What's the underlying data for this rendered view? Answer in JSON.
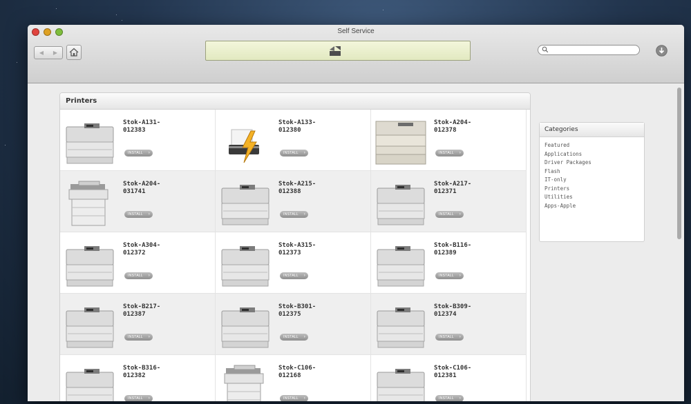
{
  "window": {
    "title": "Self Service",
    "search_placeholder": "",
    "nav_back_label": "◀",
    "nav_forward_label": "▶"
  },
  "printers_panel": {
    "title": "Printers",
    "items": [
      {
        "name": "Stok-A131-\n012383",
        "button": "INSTALL",
        "icon": "laser-printer-icon"
      },
      {
        "name": "Stok-A133-\n012380",
        "button": "INSTALL",
        "icon": "printer-lightning-icon"
      },
      {
        "name": "Stok-A204-\n012378",
        "button": "INSTALL",
        "icon": "tray-printer-icon"
      },
      {
        "name": "Stok-A204-\n031741",
        "button": "INSTALL",
        "icon": "copier-icon"
      },
      {
        "name": "Stok-A215-\n012388",
        "button": "INSTALL",
        "icon": "laser-printer-icon"
      },
      {
        "name": "Stok-A217-\n012371",
        "button": "INSTALL",
        "icon": "laser-printer-icon"
      },
      {
        "name": "Stok-A304-\n012372",
        "button": "INSTALL",
        "icon": "laser-printer-icon"
      },
      {
        "name": "Stok-A315-\n012373",
        "button": "INSTALL",
        "icon": "laser-printer-icon"
      },
      {
        "name": "Stok-B116-\n012389",
        "button": "INSTALL",
        "icon": "laser-printer-icon"
      },
      {
        "name": "Stok-B217-\n012387",
        "button": "INSTALL",
        "icon": "laser-printer-icon"
      },
      {
        "name": "Stok-B301-\n012375",
        "button": "INSTALL",
        "icon": "laser-printer-icon"
      },
      {
        "name": "Stok-B309-\n012374",
        "button": "INSTALL",
        "icon": "laser-printer-icon"
      },
      {
        "name": "Stok-B316-\n012382",
        "button": "INSTALL",
        "icon": "laser-printer-icon"
      },
      {
        "name": "Stok-C106-\n012168",
        "button": "INSTALL",
        "icon": "copier-icon"
      },
      {
        "name": "Stok-C106-\n012381",
        "button": "INSTALL",
        "icon": "laser-printer-icon"
      }
    ]
  },
  "categories": {
    "title": "Categories",
    "items": [
      "Featured",
      "Applications",
      "Driver Packages",
      "Flash",
      "IT-only",
      "Printers",
      "Utilities",
      "Apps-Apple"
    ]
  }
}
